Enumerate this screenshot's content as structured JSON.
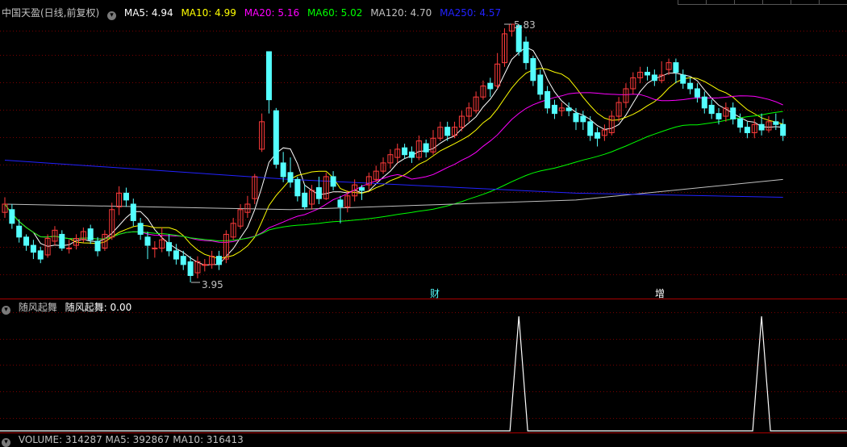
{
  "main_panel": {
    "title": "中国天盈(日线,前复权)",
    "ma": [
      {
        "label": "MA5: 4.94",
        "color": "#ffffff"
      },
      {
        "label": "MA10: 4.99",
        "color": "#ffff00"
      },
      {
        "label": "MA20: 5.16",
        "color": "#ff00ff"
      },
      {
        "label": "MA60: 5.02",
        "color": "#00ff00"
      },
      {
        "label": "MA120: 4.70",
        "color": "#c0c0c0"
      },
      {
        "label": "MA250: 4.57",
        "color": "#2222ff"
      }
    ],
    "high_label": "5.83",
    "low_label": "3.95",
    "markers": [
      {
        "text": "财"
      },
      {
        "text": "增"
      }
    ]
  },
  "indicator_panel": {
    "name": "随风起舞",
    "value_label": "随风起舞: 0.00"
  },
  "volume_panel": {
    "label": "VOLUME: 314287  MA5: 392867  MA10: 316413"
  },
  "colors": {
    "up": "#ff3b3b",
    "down": "#54ffff",
    "grid": "#7a0000",
    "divider": "#aa0000",
    "ma5": "#ffffff",
    "ma10": "#ffff00",
    "ma20": "#ff00ff",
    "ma60": "#00ff00",
    "ma120": "#c0c0c0",
    "ma250": "#2222ff",
    "signal": "#ffffff"
  },
  "chart_data": {
    "type": "candlestick",
    "y_range": [
      3.95,
      5.83
    ],
    "candles": [
      [
        4.46,
        4.52,
        4.57,
        4.42
      ],
      [
        4.48,
        4.38,
        4.52,
        4.34
      ],
      [
        4.36,
        4.28,
        4.41,
        4.24
      ],
      [
        4.28,
        4.22,
        4.3,
        4.18
      ],
      [
        4.22,
        4.17,
        4.26,
        4.12
      ],
      [
        4.18,
        4.12,
        4.21,
        4.09
      ],
      [
        4.15,
        4.27,
        4.3,
        4.13
      ],
      [
        4.25,
        4.33,
        4.36,
        4.22
      ],
      [
        4.3,
        4.2,
        4.33,
        4.18
      ],
      [
        4.2,
        4.2,
        4.26,
        4.16
      ],
      [
        4.22,
        4.27,
        4.3,
        4.19
      ],
      [
        4.26,
        4.32,
        4.35,
        4.24
      ],
      [
        4.34,
        4.26,
        4.37,
        4.23
      ],
      [
        4.25,
        4.18,
        4.28,
        4.14
      ],
      [
        4.2,
        4.3,
        4.33,
        4.18
      ],
      [
        4.28,
        4.48,
        4.53,
        4.26
      ],
      [
        4.5,
        4.6,
        4.65,
        4.44
      ],
      [
        4.6,
        4.55,
        4.64,
        4.5
      ],
      [
        4.52,
        4.4,
        4.56,
        4.36
      ],
      [
        4.38,
        4.3,
        4.42,
        4.26
      ],
      [
        4.28,
        4.22,
        4.32,
        4.12
      ],
      [
        4.2,
        4.2,
        4.25,
        4.13
      ],
      [
        4.2,
        4.26,
        4.35,
        4.17
      ],
      [
        4.24,
        4.18,
        4.3,
        4.14
      ],
      [
        4.18,
        4.12,
        4.23,
        4.08
      ],
      [
        4.14,
        4.08,
        4.18,
        4.04
      ],
      [
        4.1,
        4.0,
        4.14,
        3.95
      ],
      [
        4.02,
        4.1,
        4.14,
        3.98
      ],
      [
        4.08,
        4.08,
        4.12,
        4.03
      ],
      [
        4.08,
        4.14,
        4.18,
        4.05
      ],
      [
        4.14,
        4.08,
        4.18,
        4.04
      ],
      [
        4.12,
        4.3,
        4.33,
        4.09
      ],
      [
        4.28,
        4.38,
        4.42,
        4.26
      ],
      [
        4.36,
        4.48,
        4.52,
        4.34
      ],
      [
        4.46,
        4.52,
        4.58,
        4.42
      ],
      [
        4.56,
        4.72,
        4.74,
        4.52
      ],
      [
        4.92,
        5.12,
        5.18,
        4.9
      ],
      [
        5.63,
        5.28,
        5.63,
        5.18
      ],
      [
        5.2,
        4.81,
        5.22,
        4.78
      ],
      [
        4.82,
        4.72,
        4.9,
        4.68
      ],
      [
        4.75,
        4.68,
        4.86,
        4.64
      ],
      [
        4.7,
        4.58,
        4.72,
        4.54
      ],
      [
        4.6,
        4.5,
        4.66,
        4.48
      ],
      [
        4.52,
        4.62,
        4.66,
        4.48
      ],
      [
        4.64,
        4.56,
        4.72,
        4.52
      ],
      [
        4.56,
        4.72,
        4.75,
        4.55
      ],
      [
        4.72,
        4.65,
        4.76,
        4.62
      ],
      [
        4.55,
        4.5,
        4.58,
        4.38
      ],
      [
        4.5,
        4.58,
        4.62,
        4.46
      ],
      [
        4.58,
        4.66,
        4.7,
        4.54
      ],
      [
        4.64,
        4.62,
        4.66,
        4.55
      ],
      [
        4.66,
        4.72,
        4.75,
        4.62
      ],
      [
        4.7,
        4.76,
        4.8,
        4.68
      ],
      [
        4.76,
        4.82,
        4.86,
        4.74
      ],
      [
        4.82,
        4.88,
        4.92,
        4.78
      ],
      [
        4.86,
        4.92,
        4.96,
        4.82
      ],
      [
        4.93,
        4.88,
        4.96,
        4.85
      ],
      [
        4.9,
        4.86,
        4.94,
        4.82
      ],
      [
        4.86,
        4.98,
        5.02,
        4.84
      ],
      [
        4.96,
        4.9,
        4.99,
        4.86
      ],
      [
        4.9,
        5.0,
        5.06,
        4.88
      ],
      [
        5.0,
        5.08,
        5.12,
        4.98
      ],
      [
        5.08,
        5.02,
        5.12,
        4.98
      ],
      [
        5.02,
        5.08,
        5.12,
        5.0
      ],
      [
        5.08,
        5.16,
        5.2,
        5.05
      ],
      [
        5.16,
        5.22,
        5.26,
        5.12
      ],
      [
        5.2,
        5.3,
        5.34,
        5.18
      ],
      [
        5.3,
        5.38,
        5.42,
        5.28
      ],
      [
        5.4,
        5.36,
        5.44,
        5.3
      ],
      [
        5.38,
        5.54,
        5.62,
        5.36
      ],
      [
        5.55,
        5.76,
        5.8,
        5.52
      ],
      [
        5.78,
        5.83,
        5.83,
        5.74
      ],
      [
        5.82,
        5.63,
        5.83,
        5.6
      ],
      [
        5.7,
        5.55,
        5.74,
        5.5
      ],
      [
        5.58,
        5.42,
        5.6,
        5.38
      ],
      [
        5.46,
        5.32,
        5.5,
        5.28
      ],
      [
        5.34,
        5.22,
        5.38,
        5.18
      ],
      [
        5.24,
        5.18,
        5.28,
        5.14
      ],
      [
        5.2,
        5.22,
        5.26,
        5.16
      ],
      [
        5.22,
        5.2,
        5.26,
        5.16
      ],
      [
        5.18,
        5.12,
        5.22,
        5.06
      ],
      [
        5.16,
        5.12,
        5.2,
        5.06
      ],
      [
        5.12,
        5.02,
        5.16,
        4.98
      ],
      [
        5.04,
        5.0,
        5.08,
        4.94
      ],
      [
        5.02,
        5.06,
        5.1,
        4.98
      ],
      [
        5.04,
        5.16,
        5.2,
        5.02
      ],
      [
        5.16,
        5.26,
        5.3,
        5.12
      ],
      [
        5.26,
        5.36,
        5.4,
        5.22
      ],
      [
        5.36,
        5.44,
        5.48,
        5.32
      ],
      [
        5.44,
        5.48,
        5.52,
        5.4
      ],
      [
        5.48,
        5.46,
        5.52,
        5.42
      ],
      [
        5.46,
        5.42,
        5.5,
        5.38
      ],
      [
        5.42,
        5.46,
        5.56,
        5.4
      ],
      [
        5.5,
        5.55,
        5.58,
        5.46
      ],
      [
        5.55,
        5.48,
        5.58,
        5.4
      ],
      [
        5.46,
        5.4,
        5.5,
        5.36
      ],
      [
        5.4,
        5.36,
        5.44,
        5.32
      ],
      [
        5.36,
        5.3,
        5.4,
        5.26
      ],
      [
        5.3,
        5.22,
        5.34,
        5.18
      ],
      [
        5.24,
        5.18,
        5.28,
        5.14
      ],
      [
        5.18,
        5.14,
        5.22,
        5.1
      ],
      [
        5.16,
        5.22,
        5.26,
        5.12
      ],
      [
        5.22,
        5.14,
        5.26,
        5.1
      ],
      [
        5.14,
        5.08,
        5.18,
        5.04
      ],
      [
        5.08,
        5.04,
        5.12,
        5.0
      ],
      [
        5.04,
        5.1,
        5.14,
        5.0
      ],
      [
        5.1,
        5.06,
        5.18,
        5.02
      ],
      [
        5.06,
        5.12,
        5.16,
        5.04
      ],
      [
        5.12,
        5.1,
        5.18,
        5.06
      ],
      [
        5.1,
        5.02,
        5.14,
        4.98
      ]
    ],
    "indicator_signals": [
      72,
      106
    ]
  }
}
